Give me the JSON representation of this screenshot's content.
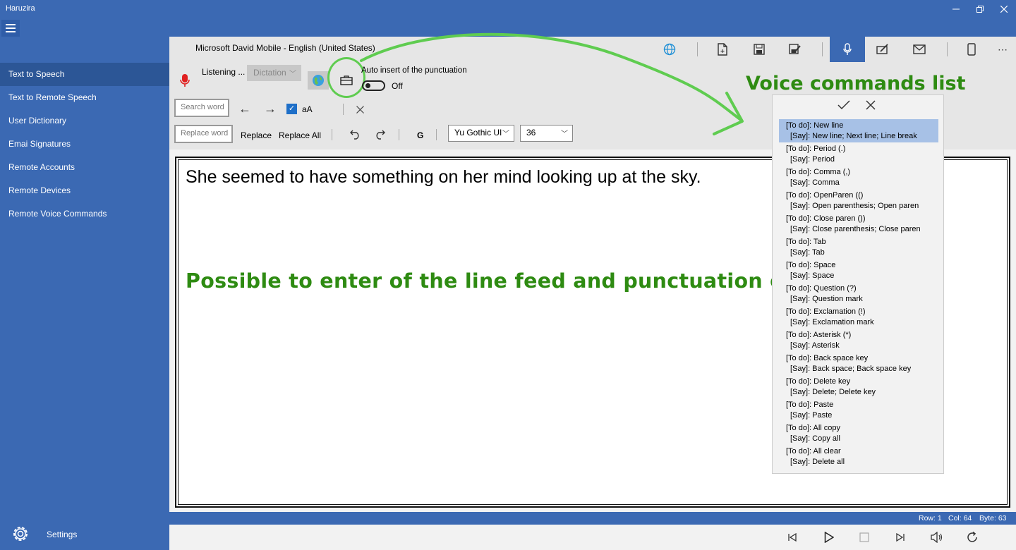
{
  "app": {
    "title": "Haruzira"
  },
  "window_controls": [
    "minimize",
    "restore",
    "close"
  ],
  "sidebar": {
    "items": [
      {
        "label": "Text to Speech",
        "active": true
      },
      {
        "label": "Text to Remote Speech"
      },
      {
        "label": "User Dictionary"
      },
      {
        "label": "Emai Signatures"
      },
      {
        "label": "Remote Accounts"
      },
      {
        "label": "Remote Devices"
      },
      {
        "label": "Remote Voice Commands"
      }
    ],
    "settings_label": "Settings"
  },
  "toolbar": {
    "voice_name": "Microsoft David Mobile - English (United States)",
    "listening_label": "Listening ...",
    "dictation_value": "Dictation",
    "auto_punct_label": "Auto insert of the punctuation",
    "auto_punct_state": "Off",
    "search_placeholder": "Search word",
    "match_case_label": "aA",
    "replace_placeholder": "Replace word",
    "replace_label": "Replace",
    "replace_all_label": "Replace All",
    "bold_label": "G",
    "font_family": "Yu Gothic UI",
    "font_size": "36"
  },
  "editor": {
    "text": "She seemed to have something on her mind looking up at the sky.",
    "promo_overlay": "Possible to enter of the line feed and punctuation etc."
  },
  "status": {
    "row": "Row: 1",
    "col": "Col: 64",
    "byte": "Byte: 63"
  },
  "voice_commands": {
    "title": "Voice commands list",
    "items": [
      {
        "todo": "[To do]: New line",
        "say": "[Say]: New line; Next line; Line break",
        "selected": true
      },
      {
        "todo": "[To do]: Period (.)",
        "say": "[Say]: Period"
      },
      {
        "todo": "[To do]: Comma (,)",
        "say": "[Say]: Comma"
      },
      {
        "todo": "[To do]: OpenParen (()",
        "say": "[Say]: Open parenthesis; Open paren"
      },
      {
        "todo": "[To do]: Close paren ())",
        "say": "[Say]: Close parenthesis; Close paren"
      },
      {
        "todo": "[To do]: Tab",
        "say": "[Say]: Tab"
      },
      {
        "todo": "[To do]: Space",
        "say": "[Say]: Space"
      },
      {
        "todo": "[To do]: Question (?)",
        "say": "[Say]: Question mark"
      },
      {
        "todo": "[To do]: Exclamation (!)",
        "say": "[Say]: Exclamation mark"
      },
      {
        "todo": "[To do]: Asterisk (*)",
        "say": "[Say]: Asterisk"
      },
      {
        "todo": "[To do]: Back space key",
        "say": "[Say]: Back space; Back space key"
      },
      {
        "todo": "[To do]: Delete key",
        "say": "[Say]: Delete; Delete key"
      },
      {
        "todo": "[To do]: Paste",
        "say": "[Say]: Paste"
      },
      {
        "todo": "[To do]: All copy",
        "say": "[Say]: Copy all"
      },
      {
        "todo": "[To do]: All clear",
        "say": "[Say]: Delete all"
      }
    ]
  },
  "colors": {
    "accent": "#3b69b3",
    "annotation_green": "#2e8b12",
    "highlight_circle": "#5fcc50",
    "selection": "#a7c1e6"
  }
}
